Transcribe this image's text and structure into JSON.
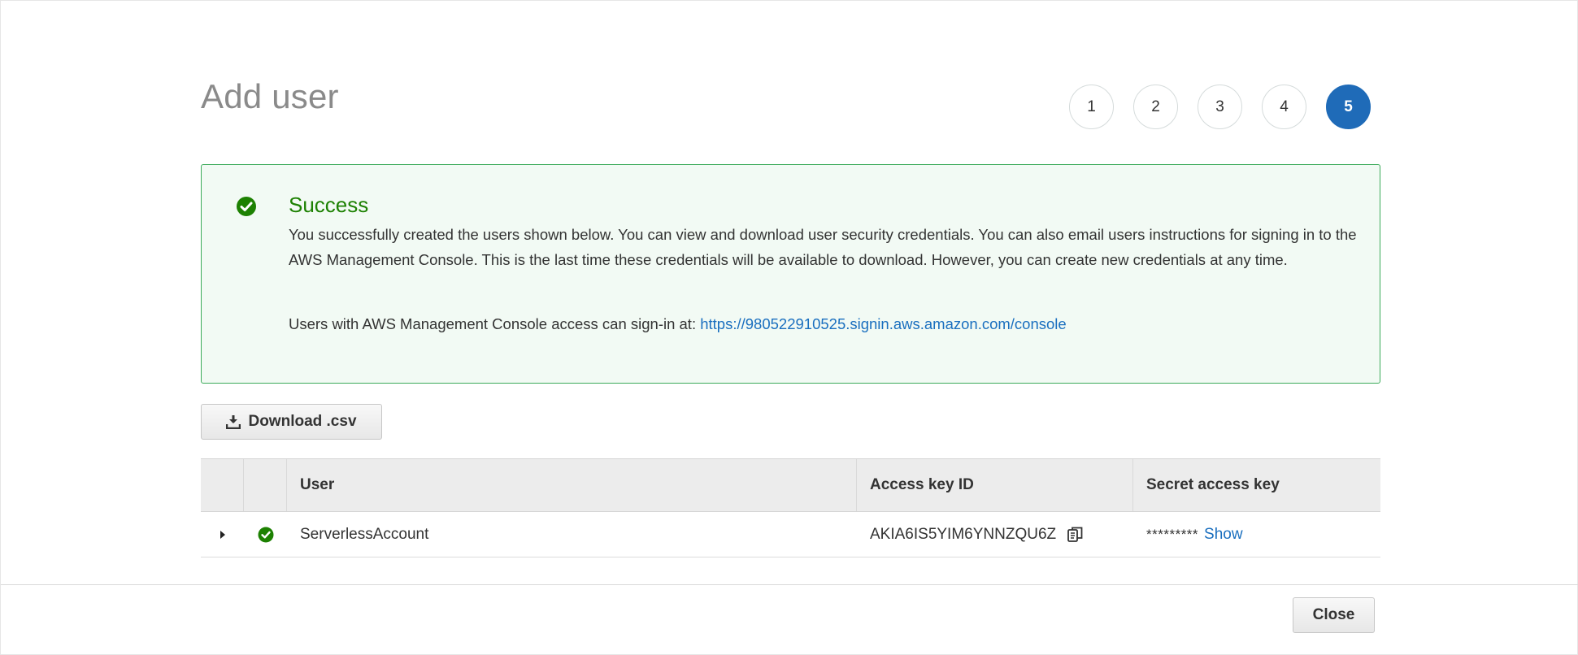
{
  "page": {
    "title": "Add user"
  },
  "steps": [
    {
      "label": "1",
      "active": false
    },
    {
      "label": "2",
      "active": false
    },
    {
      "label": "3",
      "active": false
    },
    {
      "label": "4",
      "active": false
    },
    {
      "label": "5",
      "active": true
    }
  ],
  "alert": {
    "icon": "check-circle-icon",
    "title": "Success",
    "body": "You successfully created the users shown below. You can view and download user security credentials. You can also email users instructions for signing in to the AWS Management Console. This is the last time these credentials will be available to download. However, you can create new credentials at any time.",
    "signin_text": "Users with AWS Management Console access can sign-in at:",
    "signin_url": "https://980522910525.signin.aws.amazon.com/console"
  },
  "toolbar": {
    "download_label": "Download .csv",
    "download_icon": "download-icon"
  },
  "table": {
    "headers": [
      "",
      "",
      "User",
      "Access key ID",
      "Secret access key"
    ],
    "rows": [
      {
        "user": "ServerlessAccount",
        "access_key_id": "AKIA6IS5YIM6YNNZQU6Z",
        "secret_masked": "*********",
        "show_label": "Show"
      }
    ]
  },
  "footer": {
    "close_label": "Close"
  },
  "colors": {
    "success": "#1d8102",
    "link": "#1a6fbf",
    "active_step": "#1f6bb8"
  }
}
